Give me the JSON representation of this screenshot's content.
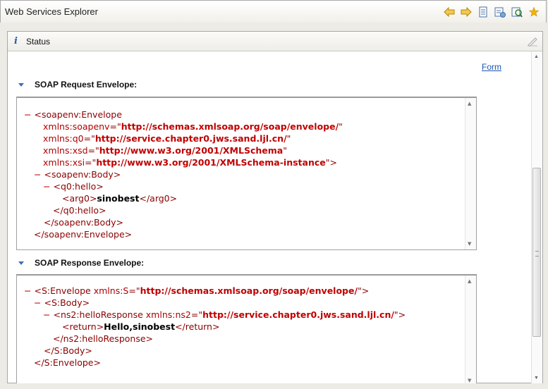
{
  "window": {
    "title": "Web Services Explorer"
  },
  "toolbar": {
    "icons": [
      "back-icon",
      "forward-icon",
      "document-icon",
      "favorites-icon",
      "wsdl-icon",
      "star-icon"
    ]
  },
  "status": {
    "label": "Status",
    "info_glyph": "i"
  },
  "form_link": "Form",
  "request": {
    "heading": "SOAP Request Envelope:",
    "toggle": "−",
    "lines": {
      "l1_tag": "<soapenv:Envelope",
      "l2_attr": "xmlns:soapenv",
      "l2_val": "http://schemas.xmlsoap.org/soap/envelope/",
      "l3_attr": "xmlns:q0",
      "l3_val": "http://service.chapter0.jws.sand.ljl.cn/",
      "l4_attr": "xmlns:xsd",
      "l4_val": "http://www.w3.org/2001/XMLSchema",
      "l5_attr": "xmlns:xsi",
      "l5_val": "http://www.w3.org/2001/XMLSchema-instance",
      "l6_tag": "<soapenv:Body>",
      "l7_tag": "<q0:hello>",
      "l8_open": "<arg0>",
      "l8_text": "sinobest",
      "l8_close": "</arg0>",
      "l9_tag": "</q0:hello>",
      "l10_tag": "</soapenv:Body>",
      "l11_tag": "</soapenv:Envelope>"
    }
  },
  "response": {
    "heading": "SOAP Response Envelope:",
    "toggle": "−",
    "lines": {
      "l1_tag": "<S:Envelope",
      "l1_attr": "xmlns:S",
      "l1_val": "http://schemas.xmlsoap.org/soap/envelope/",
      "l2_tag": "<S:Body>",
      "l3_tag": "<ns2:helloResponse",
      "l3_attr": "xmlns:ns2",
      "l3_val": "http://service.chapter0.jws.sand.ljl.cn/",
      "l4_open": "<return>",
      "l4_text": "Hello,sinobest",
      "l4_close": "</return>",
      "l5_tag": "</ns2:helloResponse>",
      "l6_tag": "</S:Body>",
      "l7_tag": "</S:Envelope>"
    }
  }
}
